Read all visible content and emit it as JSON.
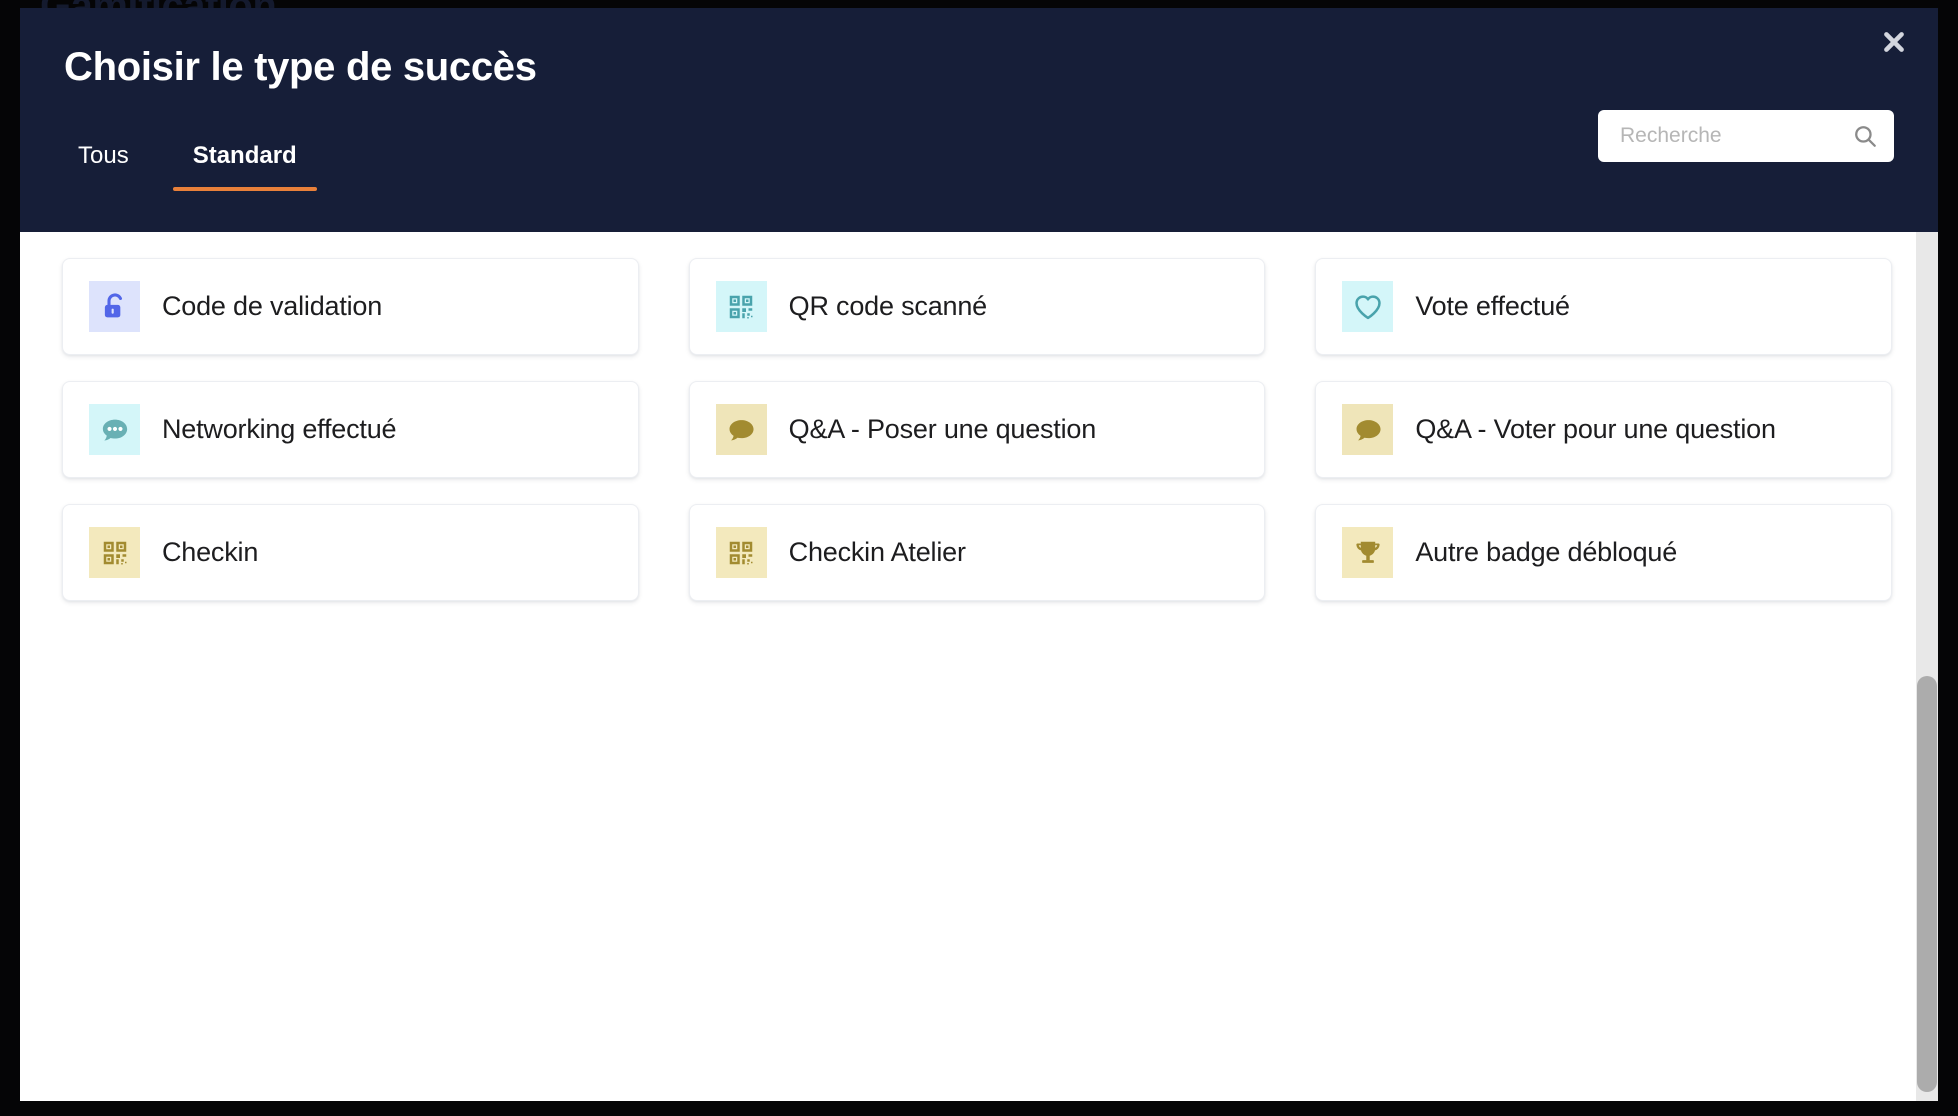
{
  "background": {
    "behind_title": "Gamification",
    "overlay_color": "#050506"
  },
  "modal": {
    "title": "Choisir le type de succès",
    "close_label": "✕",
    "header_color": "#161e38",
    "accent_color": "#e8803a",
    "tabs": [
      {
        "label": "Tous",
        "active": false
      },
      {
        "label": "Standard",
        "active": true
      }
    ],
    "search": {
      "placeholder": "Recherche",
      "value": "",
      "icon": "search-icon"
    },
    "cards": [
      {
        "label": "Code de validation",
        "icon": "unlock-icon",
        "icon_color": "#5266e8",
        "icon_bg": "#dde3fc"
      },
      {
        "label": "QR code scanné",
        "icon": "qr-code-icon",
        "icon_color": "#49a3ac",
        "icon_bg": "#d4f6f9"
      },
      {
        "label": "Vote effectué",
        "icon": "heart-icon",
        "icon_color": "#49a3ac",
        "icon_bg": "#d4f6f9"
      },
      {
        "label": "Networking effectué",
        "icon": "chat-dots-icon",
        "icon_color": "#69b0b4",
        "icon_bg": "#d4f6f9"
      },
      {
        "label": "Q&A - Poser une question",
        "icon": "chat-bubble-icon",
        "icon_color": "#a28b30",
        "icon_bg": "#efe5b9"
      },
      {
        "label": "Q&A - Voter pour une question",
        "icon": "chat-bubble-icon",
        "icon_color": "#a28b30",
        "icon_bg": "#efe5b9"
      },
      {
        "label": "Checkin",
        "icon": "qr-code-icon",
        "icon_color": "#a28b30",
        "icon_bg": "#f3e9bd"
      },
      {
        "label": "Checkin Atelier",
        "icon": "qr-code-icon",
        "icon_color": "#a28b30",
        "icon_bg": "#f3e9bd"
      },
      {
        "label": "Autre badge débloqué",
        "icon": "trophy-icon",
        "icon_color": "#a28b30",
        "icon_bg": "#f3e9bd"
      }
    ]
  },
  "scrollbar": {
    "track_color": "#e8e8e8",
    "thumb_color": "#acacac"
  }
}
